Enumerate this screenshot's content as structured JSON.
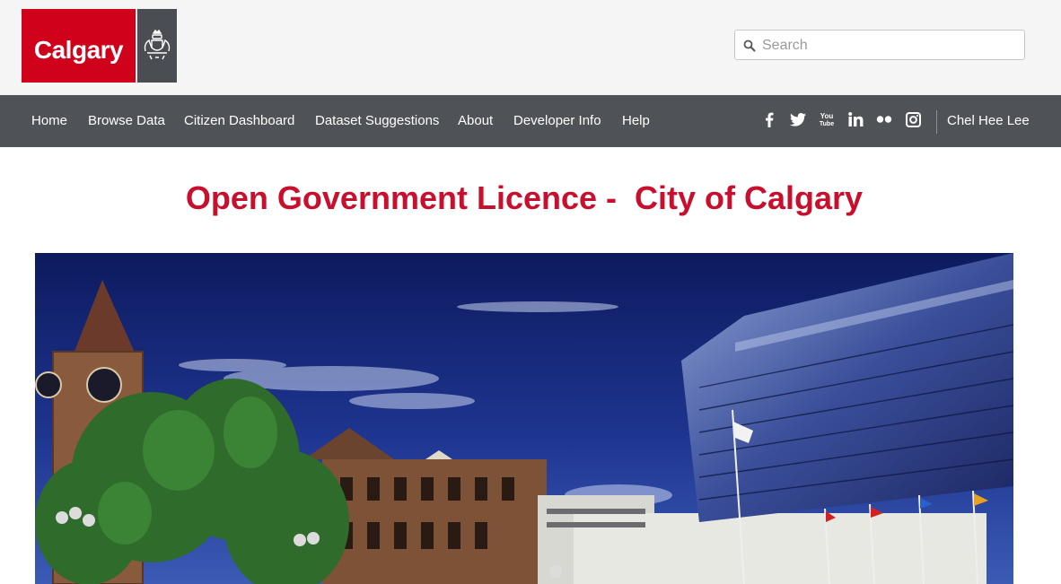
{
  "logo": {
    "text": "Calgary"
  },
  "search": {
    "placeholder": "Search",
    "value": ""
  },
  "nav": {
    "items": [
      {
        "label": "Home"
      },
      {
        "label": "Browse Data"
      },
      {
        "label": "Citizen Dashboard"
      },
      {
        "label": "Dataset Suggestions"
      },
      {
        "label": "About"
      },
      {
        "label": "Developer Info"
      },
      {
        "label": "Help"
      }
    ],
    "social_icons": [
      "facebook-icon",
      "twitter-icon",
      "youtube-icon",
      "linkedin-icon",
      "flickr-icon",
      "instagram-icon"
    ],
    "user_name": "Chel Hee Lee"
  },
  "page": {
    "title": "Open Government Licence -  City of Calgary"
  },
  "colors": {
    "brand_red": "#d0021b",
    "nav_bg": "#4f5257",
    "title_red": "#c8102e"
  }
}
